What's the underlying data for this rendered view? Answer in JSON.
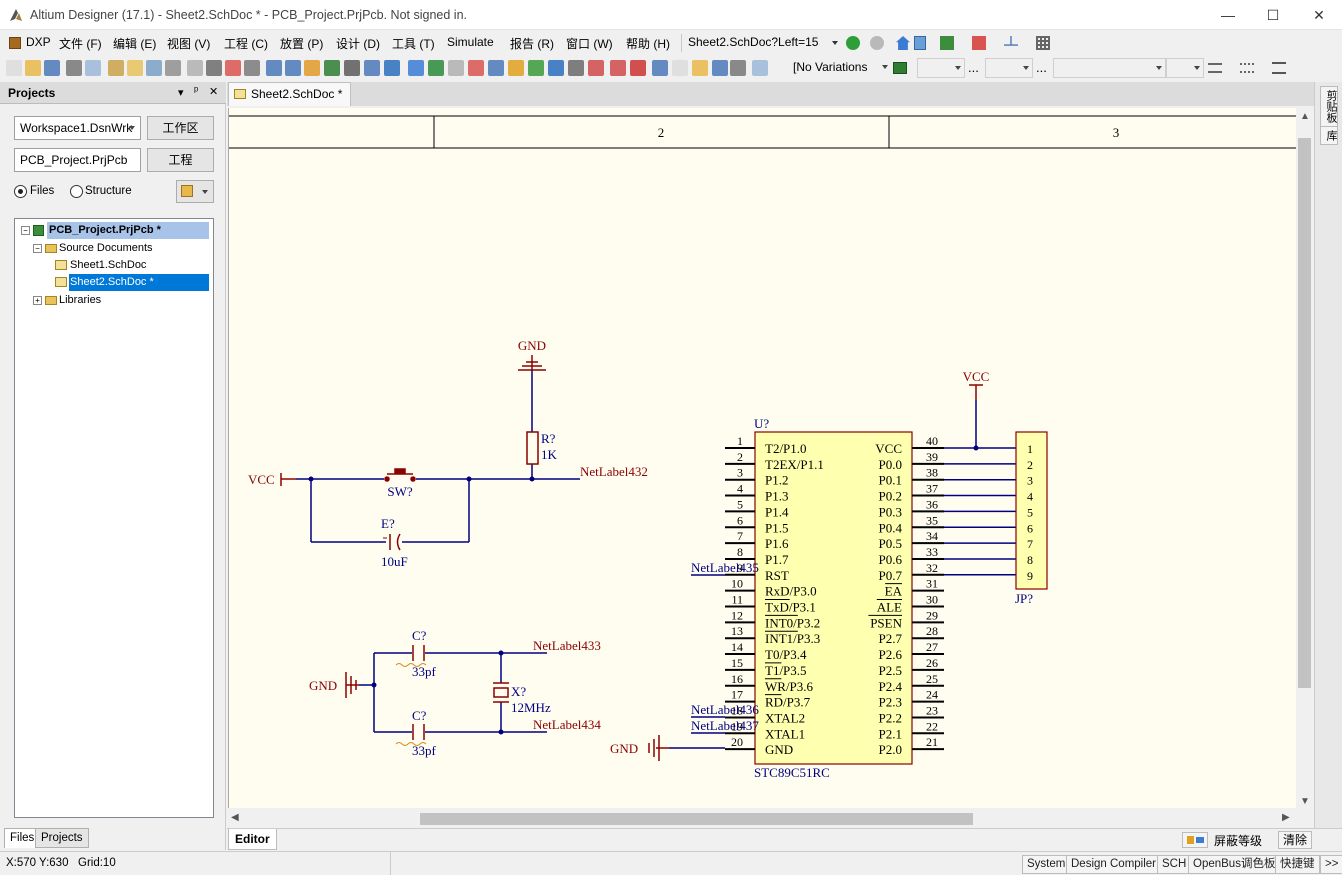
{
  "window": {
    "title": "Altium Designer (17.1) - Sheet2.SchDoc * - PCB_Project.PrjPcb. Not signed in.",
    "minimize": "—",
    "maximize": "☐",
    "close": "✕"
  },
  "menu": {
    "items": [
      "DXP",
      "文件 (F)",
      "编辑 (E)",
      "视图 (V)",
      "工程 (C)",
      "放置 (P)",
      "设计 (D)",
      "工具 (T)",
      "Simulate",
      "报告 (R)",
      "窗口 (W)",
      "帮助 (H)"
    ],
    "address": "Sheet2.SchDoc?Left=15"
  },
  "toolbar": {
    "variations": "[No Variations",
    "dots1": "...",
    "dots2": "..."
  },
  "projects_panel": {
    "title": "Projects",
    "pin_controls": [
      "▾",
      "ᵖ",
      "✕"
    ],
    "workspace": "Workspace1.DsnWrk",
    "workspace_button": "工作区",
    "project": "PCB_Project.PrjPcb",
    "project_button": "工程",
    "view_files": "Files",
    "view_structure": "Structure",
    "tree": {
      "project": "PCB_Project.PrjPcb *",
      "source_folder": "Source Documents",
      "sheet1": "Sheet1.SchDoc",
      "sheet2": "Sheet2.SchDoc *",
      "libraries": "Libraries"
    },
    "bottom_tabs": [
      "Files",
      "Projects"
    ]
  },
  "document": {
    "tab": "Sheet2.SchDoc *",
    "editor_tab": "Editor",
    "mask_level": "屏蔽等级",
    "clear": "清除"
  },
  "right_rail": [
    "剪贴板",
    "库"
  ],
  "schematic": {
    "zones": [
      "2",
      "3"
    ],
    "gnd_top": "GND",
    "r_des": "R?",
    "r_val": "1K",
    "vcc_left": "VCC",
    "sw_des": "SW?",
    "netlabel432": "NetLabel432",
    "e_des": "E?",
    "e_val": "10uF",
    "c1_des": "C?",
    "c1_val": "33pf",
    "netlabel433": "NetLabel433",
    "gnd_left": "GND",
    "x_des": "X?",
    "x_val": "12MHz",
    "c2_des": "C?",
    "c2_val": "33pf",
    "netlabel434": "NetLabel434",
    "netlabel435": "NetLabel435",
    "netlabel436": "NetLabel436",
    "netlabel437": "NetLabel437",
    "gnd_chip": "GND",
    "u_des": "U?",
    "u_part": "STC89C51RC",
    "vcc_right": "VCC",
    "jp_des": "JP?",
    "left_pins": [
      {
        "num": "1",
        "name": "T2/P1.0"
      },
      {
        "num": "2",
        "name": "T2EX/P1.1"
      },
      {
        "num": "3",
        "name": "P1.2"
      },
      {
        "num": "4",
        "name": "P1.3"
      },
      {
        "num": "5",
        "name": "P1.4"
      },
      {
        "num": "6",
        "name": "P1.5"
      },
      {
        "num": "7",
        "name": "P1.6"
      },
      {
        "num": "8",
        "name": "P1.7"
      },
      {
        "num": "9",
        "name": "RST"
      },
      {
        "num": "10",
        "name": "RxD/P3.0"
      },
      {
        "num": "11",
        "name": "TxD/P3.1"
      },
      {
        "num": "12",
        "name": "INT0/P3.2"
      },
      {
        "num": "13",
        "name": "INT1/P3.3"
      },
      {
        "num": "14",
        "name": "T0/P3.4"
      },
      {
        "num": "15",
        "name": "T1/P3.5"
      },
      {
        "num": "16",
        "name": "WR/P3.6"
      },
      {
        "num": "17",
        "name": "RD/P3.7"
      },
      {
        "num": "18",
        "name": "XTAL2"
      },
      {
        "num": "19",
        "name": "XTAL1"
      },
      {
        "num": "20",
        "name": "GND"
      }
    ],
    "right_pins": [
      {
        "num": "40",
        "name": "VCC"
      },
      {
        "num": "39",
        "name": "P0.0"
      },
      {
        "num": "38",
        "name": "P0.1"
      },
      {
        "num": "37",
        "name": "P0.2"
      },
      {
        "num": "36",
        "name": "P0.3"
      },
      {
        "num": "35",
        "name": "P0.4"
      },
      {
        "num": "34",
        "name": "P0.5"
      },
      {
        "num": "33",
        "name": "P0.6"
      },
      {
        "num": "32",
        "name": "P0.7"
      },
      {
        "num": "31",
        "name": "EA"
      },
      {
        "num": "30",
        "name": "ALE"
      },
      {
        "num": "29",
        "name": "PSEN"
      },
      {
        "num": "28",
        "name": "P2.7"
      },
      {
        "num": "27",
        "name": "P2.6"
      },
      {
        "num": "26",
        "name": "P2.5"
      },
      {
        "num": "25",
        "name": "P2.4"
      },
      {
        "num": "24",
        "name": "P2.3"
      },
      {
        "num": "23",
        "name": "P2.2"
      },
      {
        "num": "22",
        "name": "P2.1"
      },
      {
        "num": "21",
        "name": "P2.0"
      }
    ],
    "jp_pins": [
      "1",
      "2",
      "3",
      "4",
      "5",
      "6",
      "7",
      "8",
      "9"
    ]
  },
  "status": {
    "coords": "X:570 Y:630",
    "grid": "Grid:10",
    "buttons": [
      "System",
      "Design Compiler",
      "SCH",
      "OpenBus调色板",
      "快捷键",
      ">>"
    ]
  },
  "colors": {
    "sheet_bg": "#fffdf0",
    "wire": "#000080",
    "part": "#8b0000",
    "chip_fill": "#ffffb0",
    "selection": "#0078d7"
  }
}
